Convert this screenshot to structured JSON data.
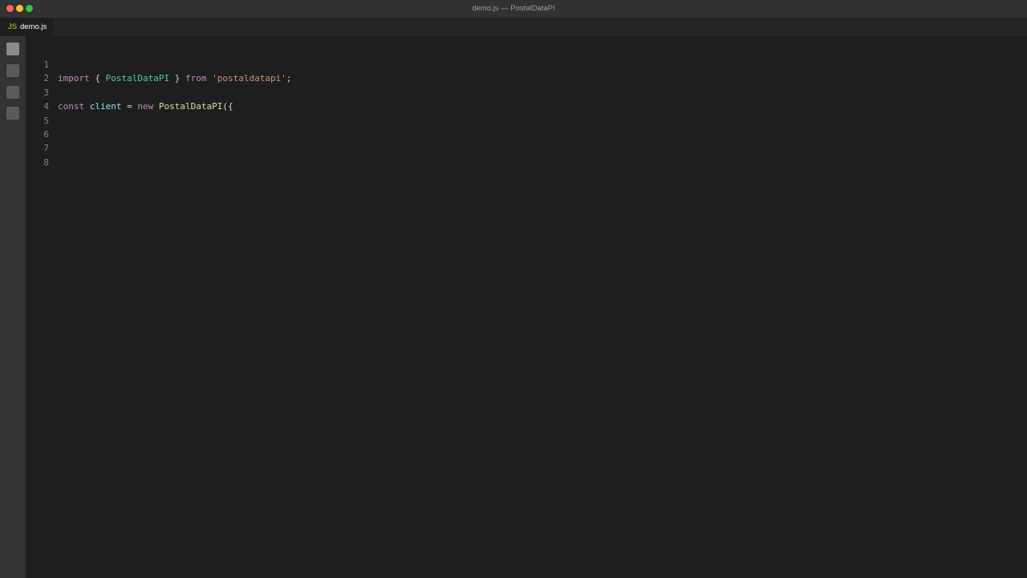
{
  "window": {
    "title": "demo.js — PostalDataPI"
  },
  "tab": {
    "icon": "JS",
    "label": "demo.js"
  },
  "activity": {
    "icons": [
      "explorer-icon",
      "search-icon",
      "source-control-icon",
      "extensions-icon"
    ]
  },
  "editor": {
    "lines": [
      {
        "num": "1"
      },
      {
        "num": "2"
      },
      {
        "num": "3"
      },
      {
        "num": "4"
      },
      {
        "num": "5"
      },
      {
        "num": "6"
      },
      {
        "num": "7"
      },
      {
        "num": "8"
      }
    ],
    "line1": {
      "t1": "import",
      "t2": " { ",
      "t3": "PostalDataPI",
      "t4": " } ",
      "t5": "from",
      "t6": " ",
      "t7": "'postaldatapi'",
      "t8": ";"
    },
    "line3": {
      "t1": "const",
      "t2": " ",
      "t3": "client",
      "t4": " = ",
      "t5": "new",
      "t6": " ",
      "t7": "PostalDataPI",
      "t8": "({"
    }
  },
  "colors": {
    "keyword": "#c586c0",
    "class": "#4ec9b0",
    "string": "#ce9178",
    "variable": "#9cdcfe",
    "function": "#dcdcaa",
    "text": "#d4d4d4",
    "line_number": "#858585",
    "background": "#1e1e1e"
  }
}
